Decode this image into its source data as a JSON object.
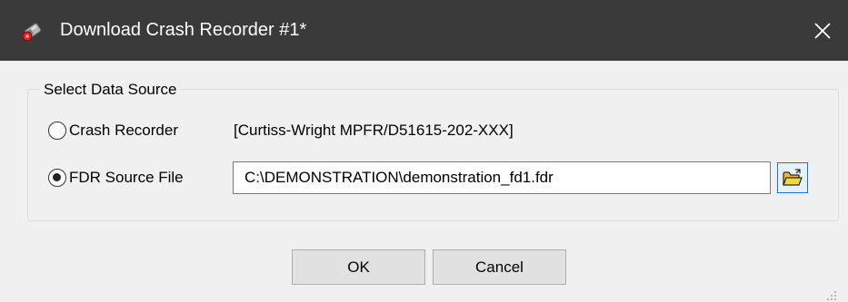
{
  "window": {
    "title": "Download Crash Recorder #1*",
    "titlebar_color": "#3a3a3a",
    "icon": "crash-recorder-app-icon",
    "close_icon": "close-icon"
  },
  "group": {
    "legend": "Select Data Source"
  },
  "source": {
    "crash_recorder": {
      "label": "Crash Recorder",
      "selected": false,
      "value": "[Curtiss-Wright MPFR/D51615-202-XXX]"
    },
    "fdr_file": {
      "label": "FDR Source File",
      "selected": true,
      "path": "C:\\DEMONSTRATION\\demonstration_fd1.fdr",
      "browse_icon": "open-folder-icon"
    }
  },
  "buttons": {
    "ok": "OK",
    "cancel": "Cancel"
  },
  "colors": {
    "dialog_bg": "#f0f0f0",
    "browse_border": "#1e73d2",
    "folder_yellow": "#f5d547"
  }
}
